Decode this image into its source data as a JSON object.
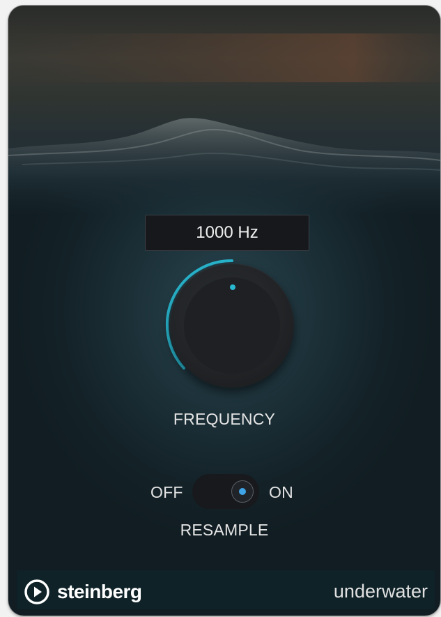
{
  "frequency": {
    "display": "1000 Hz",
    "label": "FREQUENCY"
  },
  "resample": {
    "off_label": "OFF",
    "on_label": "ON",
    "label": "RESAMPLE",
    "state": "on"
  },
  "footer": {
    "brand": "steinberg",
    "product": "underwater"
  },
  "colors": {
    "accent_arc": "#29b8d0",
    "toggle_indicator": "#3fa3e6"
  },
  "icons": {
    "brand_logo": "play-circle-icon"
  }
}
